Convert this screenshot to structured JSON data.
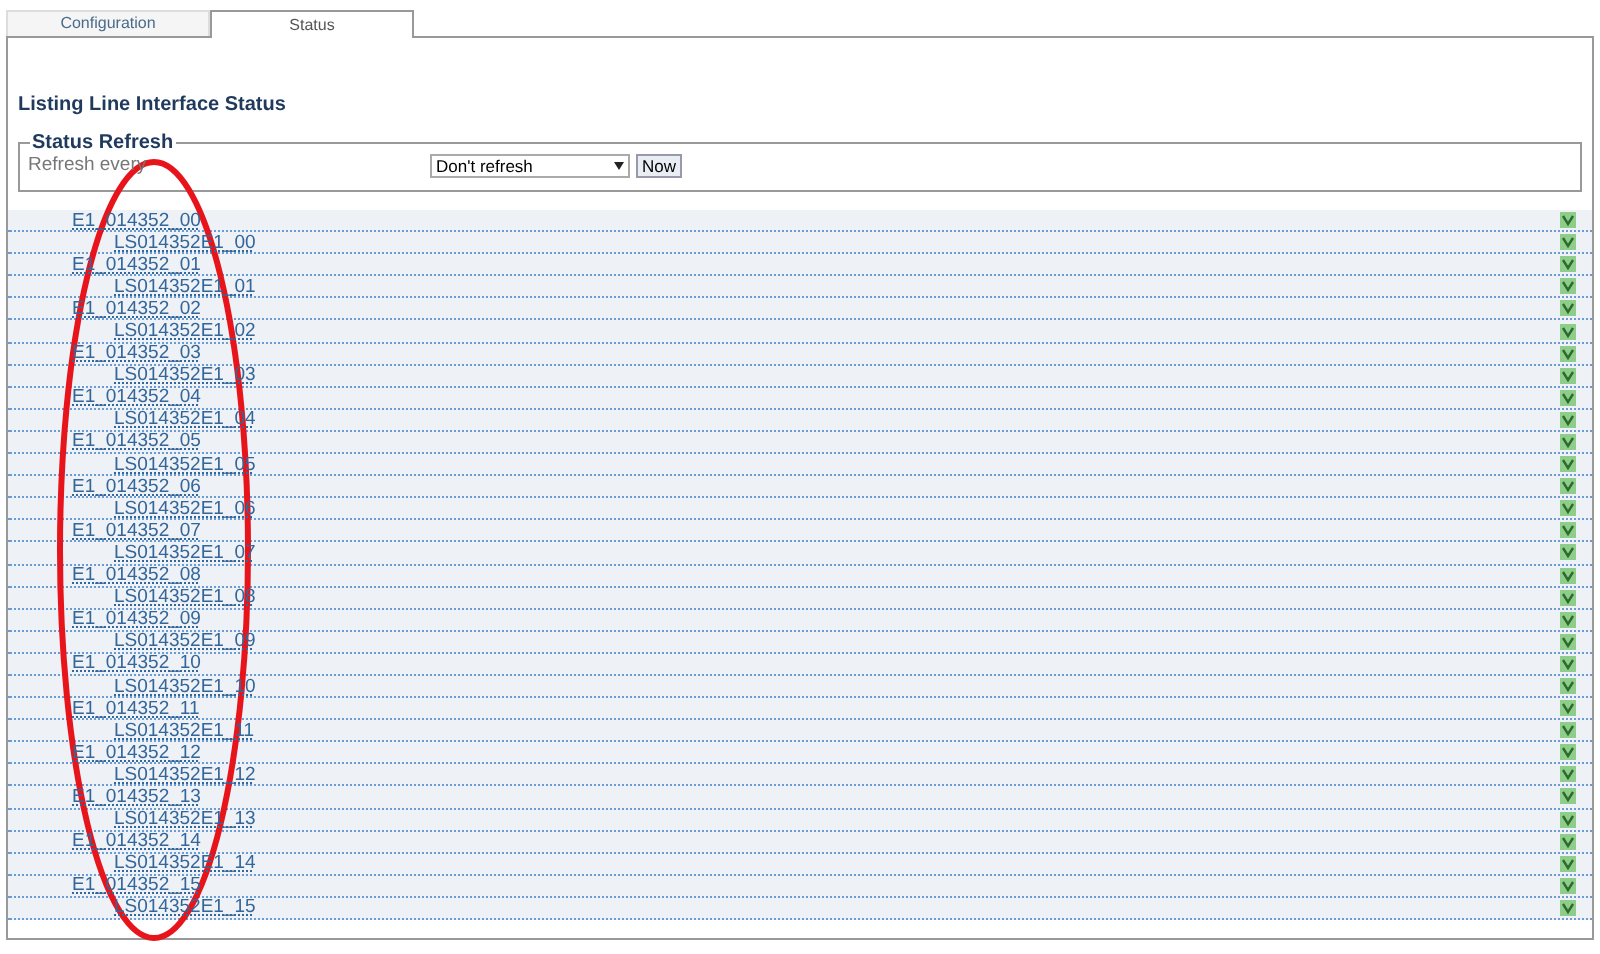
{
  "tabs": [
    {
      "label": "Configuration",
      "selected": false
    },
    {
      "label": "Status",
      "selected": true
    }
  ],
  "title": "Listing Line Interface Status",
  "refresh": {
    "legend": "Status Refresh",
    "label": "Refresh every",
    "select": "Don't refresh",
    "button": "Now"
  },
  "interfaces": [
    {
      "label": "E1_014352_00",
      "children": [
        {
          "label": "LS014352E1_00"
        }
      ]
    },
    {
      "label": "E1_014352_01",
      "children": [
        {
          "label": "LS014352E1_01"
        }
      ]
    },
    {
      "label": "E1_014352_02",
      "children": [
        {
          "label": "LS014352E1_02"
        }
      ]
    },
    {
      "label": "E1_014352_03",
      "children": [
        {
          "label": "LS014352E1_03"
        }
      ]
    },
    {
      "label": "E1_014352_04",
      "children": [
        {
          "label": "LS014352E1_04"
        }
      ]
    },
    {
      "label": "E1_014352_05",
      "children": [
        {
          "label": "LS014352E1_05"
        }
      ]
    },
    {
      "label": "E1_014352_06",
      "children": [
        {
          "label": "LS014352E1_06"
        }
      ]
    },
    {
      "label": "E1_014352_07",
      "children": [
        {
          "label": "LS014352E1_07"
        }
      ]
    },
    {
      "label": "E1_014352_08",
      "children": [
        {
          "label": "LS014352E1_08"
        }
      ]
    },
    {
      "label": "E1_014352_09",
      "children": [
        {
          "label": "LS014352E1_09"
        }
      ]
    },
    {
      "label": "E1_014352_10",
      "children": [
        {
          "label": "LS014352E1_10"
        }
      ]
    },
    {
      "label": "E1_014352_11",
      "children": [
        {
          "label": "LS014352E1_11"
        }
      ]
    },
    {
      "label": "E1_014352_12",
      "children": [
        {
          "label": "LS014352E1_12"
        }
      ]
    },
    {
      "label": "E1_014352_13",
      "children": [
        {
          "label": "LS014352E1_13"
        }
      ]
    },
    {
      "label": "E1_014352_14",
      "children": [
        {
          "label": "LS014352E1_14"
        }
      ]
    },
    {
      "label": "E1_014352_15",
      "children": [
        {
          "label": "LS014352E1_15"
        }
      ]
    }
  ]
}
